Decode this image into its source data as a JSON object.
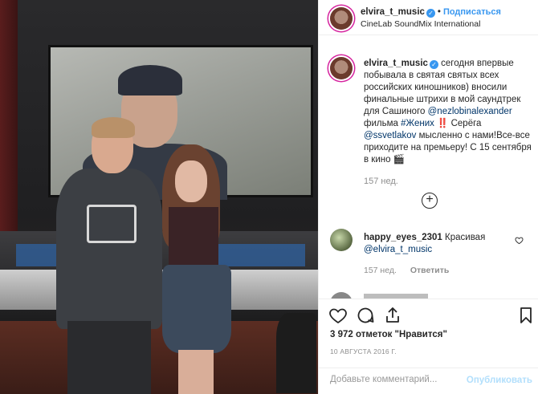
{
  "post": {
    "username": "elvira_t_music",
    "follow_label": "Подписаться",
    "location": "CineLab SoundMix International"
  },
  "caption": {
    "username": "elvira_t_music",
    "text_1": "сегодня впервые побывала в святая святых всех российских киношников) вносили финальные штрихи в мой саундтрек для Сашиного",
    "mention_1": "@nezlobinalexander",
    "text_2": "фильма",
    "hashtag": "#Жених",
    "text_3": "‼️ Серёга",
    "mention_2": "@ssvetlakov",
    "text_4": "мысленно с нами!Все-все приходите на премьеру! С 15 сентября в кино 🎬",
    "time": "157 нед."
  },
  "comments": [
    {
      "username": "happy_eyes_2301",
      "text": "Красивая",
      "mention": "@elvira_t_music",
      "time": "157 нед.",
      "reply_label": "Ответить"
    }
  ],
  "actions": {
    "likes_text": "3 972 отметок \"Нравится\"",
    "date": "10 АВГУСТА 2016 Г."
  },
  "add_comment": {
    "placeholder": "Добавьте комментарий...",
    "publish_label": "Опубликовать"
  },
  "icons": {
    "verified": "verified-badge-icon",
    "like": "heart-icon",
    "comment": "comment-icon",
    "share": "share-icon",
    "save": "bookmark-icon",
    "more": "plus-circle-icon"
  },
  "colors": {
    "accent": "#3897f0",
    "link": "#003569",
    "muted": "#8e8e8e",
    "publish_disabled": "#b2dffc"
  }
}
